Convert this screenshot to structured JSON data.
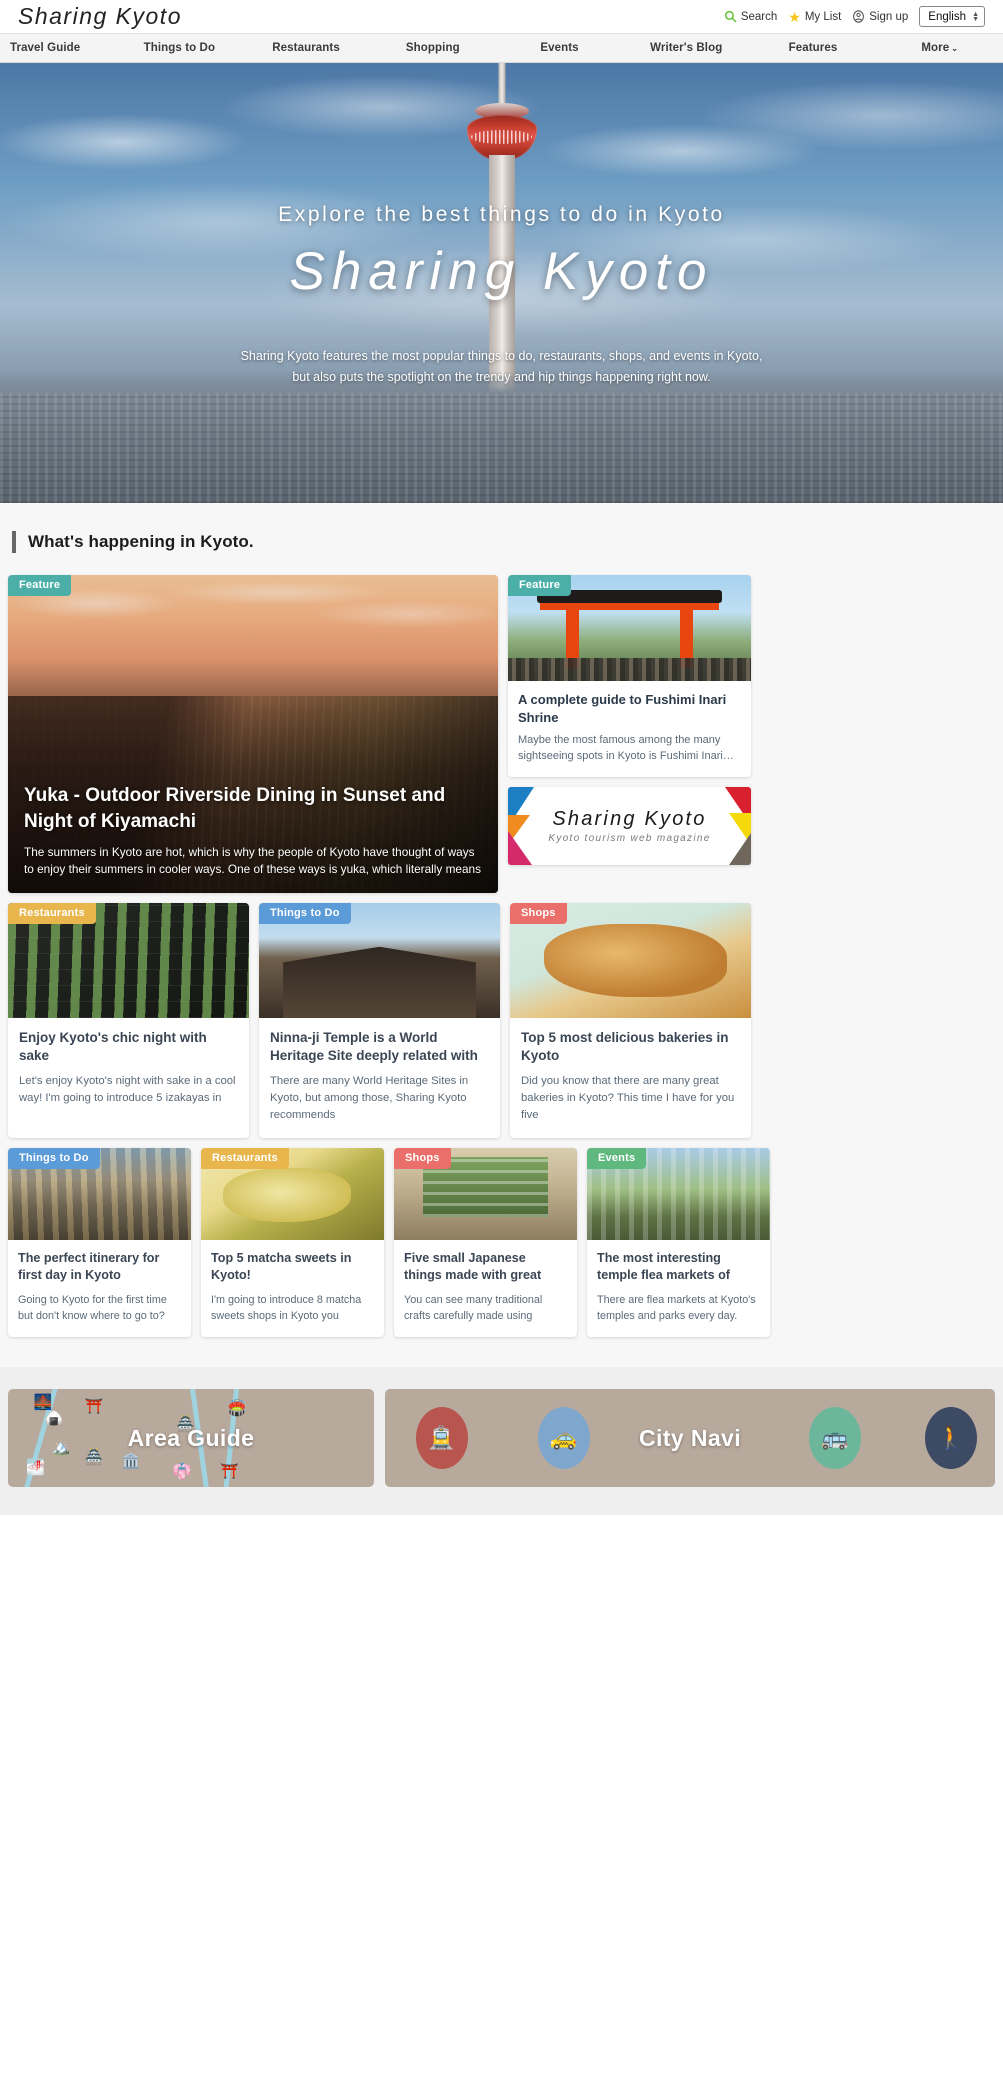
{
  "header": {
    "logo": "Sharing Kyoto",
    "search_label": "Search",
    "mylist_label": "My List",
    "signup_label": "Sign up",
    "language": "English"
  },
  "nav": {
    "items": [
      {
        "label": "Travel Guide"
      },
      {
        "label": "Things to Do"
      },
      {
        "label": "Restaurants"
      },
      {
        "label": "Shopping"
      },
      {
        "label": "Events"
      },
      {
        "label": "Writer's Blog"
      },
      {
        "label": "Features"
      },
      {
        "label": "More"
      }
    ],
    "more_caret": "⌄"
  },
  "hero": {
    "subtitle": "Explore the best things to do in Kyoto",
    "title": "Sharing Kyoto",
    "description_line1": "Sharing Kyoto features the most popular things to do, restaurants, shops, and events in Kyoto,",
    "description_line2": "but also puts the spotlight on the trendy and hip things happening right now."
  },
  "section": {
    "heading": "What's happening in Kyoto."
  },
  "feature_big": {
    "badge": "Feature",
    "badge_color": "#4bafa8",
    "title": "Yuka - Outdoor Riverside Dining in Sunset and Night of Kiyamachi",
    "excerpt": "The summers in Kyoto are hot, which is why the people of Kyoto have thought of ways to enjoy their summers in cooler ways. One of these ways is yuka, which literally means"
  },
  "feature_side": {
    "badge": "Feature",
    "badge_color": "#4bafa8",
    "title": "A complete guide to Fushimi Inari Shrine",
    "excerpt": "Maybe the most famous among the many sightseeing spots in Kyoto is Fushimi Inari…"
  },
  "ad": {
    "logo": "Sharing Kyoto",
    "tagline": "Kyoto tourism web magazine"
  },
  "cards_three": [
    {
      "badge": "Restaurants",
      "badge_color": "#e8b64c",
      "image": "im-sake",
      "title": "Enjoy Kyoto's chic night with sake",
      "excerpt": "Let's enjoy Kyoto's night with sake in a cool way! I'm going to introduce 5 izakayas in"
    },
    {
      "badge": "Things to Do",
      "badge_color": "#5b9bd8",
      "image": "im-temple",
      "title": "Ninna-ji Temple is a World Heritage Site deeply related with",
      "excerpt": "There are many World Heritage Sites in Kyoto, but among those, Sharing Kyoto recommends"
    },
    {
      "badge": "Shops",
      "badge_color": "#ea6f6a",
      "image": "im-bread",
      "title": "Top 5 most delicious bakeries in Kyoto",
      "excerpt": "Did you know that there are many great bakeries in Kyoto? This time I have for you five"
    }
  ],
  "cards_four": [
    {
      "badge": "Things to Do",
      "badge_color": "#5b9bd8",
      "image": "im-street",
      "title": "The perfect itinerary for first day in Kyoto",
      "excerpt": "Going to Kyoto for the first time but don't know where to go to?"
    },
    {
      "badge": "Restaurants",
      "badge_color": "#e8b64c",
      "image": "im-matcha",
      "title": "Top 5 matcha sweets in Kyoto!",
      "excerpt": "I'm going to introduce 8 matcha sweets shops in Kyoto you"
    },
    {
      "badge": "Shops",
      "badge_color": "#ea6f6a",
      "image": "im-window",
      "title": "Five small Japanese things made with great",
      "excerpt": "You can see many traditional crafts carefully made using"
    },
    {
      "badge": "Events",
      "badge_color": "#5fb97e",
      "image": "im-flea",
      "title": "The most interesting temple flea markets of",
      "excerpt": "There are flea markets at Kyoto's temples and parks every day."
    }
  ],
  "banners": {
    "area_guide": "Area Guide",
    "city_navi": "City Navi",
    "navi_icons": [
      "train-icon",
      "taxi-icon",
      "bus-icon",
      "walk-icon"
    ],
    "area_icons": [
      "bridge-icon",
      "onigiri-icon",
      "shrine-gate-icon",
      "mountain-icon",
      "castle-icon",
      "pagoda-icon",
      "aqueduct-icon",
      "temple-icon",
      "geisha-icon",
      "torii-icon"
    ]
  }
}
